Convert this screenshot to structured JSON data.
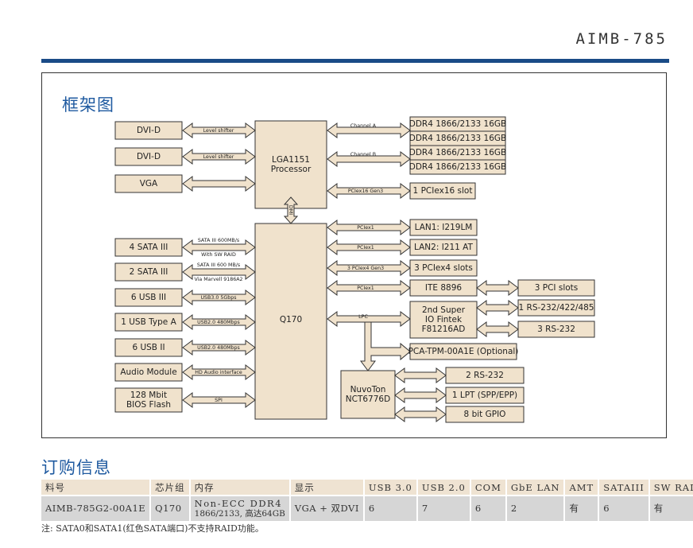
{
  "header": {
    "model": "AIMB-785",
    "accent_color": "#1a4b87"
  },
  "block_diagram": {
    "title": "框架图",
    "processor": {
      "line1": "LGA1151",
      "line2": "Processor"
    },
    "chipset": "Q170",
    "dmi_label": "DMI",
    "left_blocks": [
      {
        "label": "DVI-D",
        "link": "Level shifter",
        "target": "processor"
      },
      {
        "label": "DVI-D",
        "link": "Level shifter",
        "target": "processor"
      },
      {
        "label": "VGA",
        "link": "",
        "target": "processor"
      },
      {
        "label": "4 SATA III",
        "link": "SATA III 600MB/s",
        "link2": "With  SW RAID",
        "target": "chipset"
      },
      {
        "label": "2 SATA III",
        "link": "SATA III 600 MB/s",
        "link2": "Via Marvell 9186A2",
        "target": "chipset"
      },
      {
        "label": "6 USB III",
        "link": "USB3.0  5Gbps",
        "target": "chipset"
      },
      {
        "label": "1 USB Type A",
        "link": "USB2.0  480Mbps",
        "target": "chipset"
      },
      {
        "label": "6 USB II",
        "link": "USB2.0  480Mbps",
        "target": "chipset"
      },
      {
        "label": "Audio Module",
        "link": "HD Audio interface",
        "target": "chipset"
      },
      {
        "label": "128 Mbit",
        "label2": "BIOS Flash",
        "link": "SPI",
        "target": "chipset"
      }
    ],
    "memory": {
      "channel_a": {
        "link": "Channel A",
        "dimms": [
          "DDR4 1866/2133 16GB",
          "DDR4 1866/2133 16GB"
        ]
      },
      "channel_b": {
        "link": "Channel B",
        "dimms": [
          "DDR4 1866/2133 16GB",
          "DDR4 1866/2133 16GB"
        ]
      }
    },
    "pcie_x16": {
      "link": "PCIex16  Gen3",
      "label": "1 PCIex16 slot"
    },
    "right_blocks": [
      {
        "label": "LAN1: I219LM",
        "link": "PCIex1"
      },
      {
        "label": "LAN2: I211 AT",
        "link": "PCIex1"
      },
      {
        "label": "3 PCIex4 slots",
        "link": "3 PCIex4 Gen3"
      },
      {
        "label": "ITE 8896",
        "link": "PCIex1"
      }
    ],
    "ite_child": "3 PCI slots",
    "lpc_label": "LPC",
    "superio": {
      "line1": "2nd Super",
      "line2": "IO Fintek",
      "line3": "F81216AD"
    },
    "superio_children": [
      "1 RS-232/422/485",
      "3 RS-232"
    ],
    "tpm": "PCA-TPM-00A1E (Optional)",
    "nuvoton": {
      "line1": "NuvoTon",
      "line2": "NCT6776D"
    },
    "nuvoton_children": [
      "2 RS-232",
      "1 LPT (SPP/EPP)",
      "8 bit GPIO"
    ]
  },
  "ordering": {
    "title": "订购信息",
    "columns": [
      "料号",
      "芯片组",
      "内存",
      "显示",
      "USB 3.0",
      "USB 2.0",
      "COM",
      "GbE LAN",
      "AMT",
      "SATAIII",
      "SW RAID"
    ],
    "rows": [
      {
        "part": "AIMB-785G2-00A1E",
        "chipset": "Q170",
        "memory_line1": "Non-ECC DDR4",
        "memory_line2": "1866/2133, 高达64GB",
        "display": "VGA + 双DVI",
        "usb3": "6",
        "usb2": "7",
        "com": "6",
        "lan": "2",
        "amt": "有",
        "sata": "6",
        "raid": "有"
      }
    ],
    "note": "注: SATA0和SATA1(红色SATA端口)不支持RAID功能。"
  }
}
